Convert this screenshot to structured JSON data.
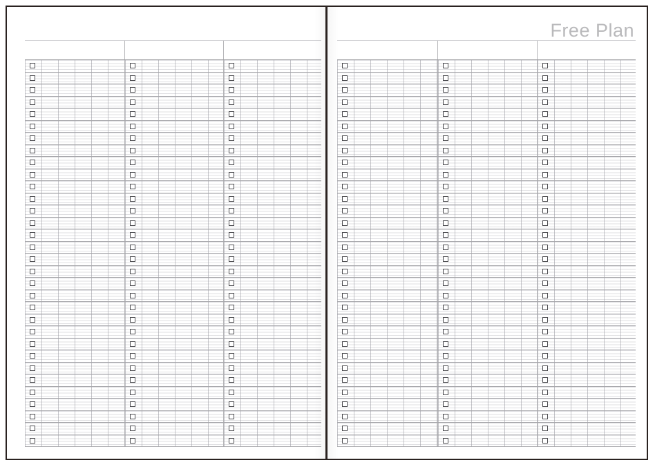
{
  "document": {
    "kind": "printable-planner-spread",
    "orientation": "two-page-spread"
  },
  "colors": {
    "frame": "#2a2220",
    "rule_strong": "#9c9ca0",
    "rule_row": "#a8a8ac",
    "rule_light": "#cfcfd2",
    "column_separator": "#b5b5b8",
    "checkbox_border": "#4b4b4f",
    "title_text": "#b9b9bb",
    "paper": "#ffffff"
  },
  "pages": [
    {
      "id": "left-page",
      "title": "",
      "columns": [
        {
          "id": "col-1",
          "header": ""
        },
        {
          "id": "col-2",
          "header": ""
        },
        {
          "id": "col-3",
          "header": ""
        }
      ],
      "row_count": 32,
      "checkbox_symbol": "empty-square"
    },
    {
      "id": "right-page",
      "title": "Free Plan",
      "columns": [
        {
          "id": "col-1",
          "header": ""
        },
        {
          "id": "col-2",
          "header": ""
        },
        {
          "id": "col-3",
          "header": ""
        }
      ],
      "row_count": 32,
      "checkbox_symbol": "empty-square"
    }
  ]
}
